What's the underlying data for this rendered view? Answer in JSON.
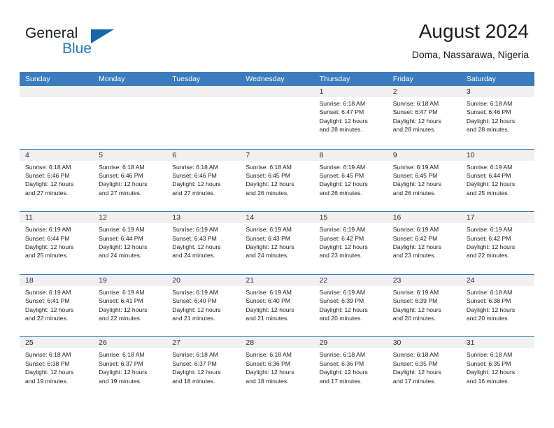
{
  "brand": {
    "word1": "General",
    "word2": "Blue",
    "flag_icon": "triangle-flag-icon",
    "accent_color": "#1566ab",
    "text_color": "#1f7ac4"
  },
  "header": {
    "title": "August 2024",
    "subtitle": "Doma, Nassarawa, Nigeria"
  },
  "calendar": {
    "header_bg": "#3a7cbe",
    "day_header_bg": "#f0f0f0",
    "weekdays": [
      "Sunday",
      "Monday",
      "Tuesday",
      "Wednesday",
      "Thursday",
      "Friday",
      "Saturday"
    ],
    "weeks": [
      [
        {
          "day": "",
          "lines": []
        },
        {
          "day": "",
          "lines": []
        },
        {
          "day": "",
          "lines": []
        },
        {
          "day": "",
          "lines": []
        },
        {
          "day": "1",
          "lines": [
            "Sunrise: 6:18 AM",
            "Sunset: 6:47 PM",
            "Daylight: 12 hours",
            "and 28 minutes."
          ]
        },
        {
          "day": "2",
          "lines": [
            "Sunrise: 6:18 AM",
            "Sunset: 6:47 PM",
            "Daylight: 12 hours",
            "and 28 minutes."
          ]
        },
        {
          "day": "3",
          "lines": [
            "Sunrise: 6:18 AM",
            "Sunset: 6:46 PM",
            "Daylight: 12 hours",
            "and 28 minutes."
          ]
        }
      ],
      [
        {
          "day": "4",
          "lines": [
            "Sunrise: 6:18 AM",
            "Sunset: 6:46 PM",
            "Daylight: 12 hours",
            "and 27 minutes."
          ]
        },
        {
          "day": "5",
          "lines": [
            "Sunrise: 6:18 AM",
            "Sunset: 6:46 PM",
            "Daylight: 12 hours",
            "and 27 minutes."
          ]
        },
        {
          "day": "6",
          "lines": [
            "Sunrise: 6:18 AM",
            "Sunset: 6:46 PM",
            "Daylight: 12 hours",
            "and 27 minutes."
          ]
        },
        {
          "day": "7",
          "lines": [
            "Sunrise: 6:18 AM",
            "Sunset: 6:45 PM",
            "Daylight: 12 hours",
            "and 26 minutes."
          ]
        },
        {
          "day": "8",
          "lines": [
            "Sunrise: 6:19 AM",
            "Sunset: 6:45 PM",
            "Daylight: 12 hours",
            "and 26 minutes."
          ]
        },
        {
          "day": "9",
          "lines": [
            "Sunrise: 6:19 AM",
            "Sunset: 6:45 PM",
            "Daylight: 12 hours",
            "and 26 minutes."
          ]
        },
        {
          "day": "10",
          "lines": [
            "Sunrise: 6:19 AM",
            "Sunset: 6:44 PM",
            "Daylight: 12 hours",
            "and 25 minutes."
          ]
        }
      ],
      [
        {
          "day": "11",
          "lines": [
            "Sunrise: 6:19 AM",
            "Sunset: 6:44 PM",
            "Daylight: 12 hours",
            "and 25 minutes."
          ]
        },
        {
          "day": "12",
          "lines": [
            "Sunrise: 6:19 AM",
            "Sunset: 6:44 PM",
            "Daylight: 12 hours",
            "and 24 minutes."
          ]
        },
        {
          "day": "13",
          "lines": [
            "Sunrise: 6:19 AM",
            "Sunset: 6:43 PM",
            "Daylight: 12 hours",
            "and 24 minutes."
          ]
        },
        {
          "day": "14",
          "lines": [
            "Sunrise: 6:19 AM",
            "Sunset: 6:43 PM",
            "Daylight: 12 hours",
            "and 24 minutes."
          ]
        },
        {
          "day": "15",
          "lines": [
            "Sunrise: 6:19 AM",
            "Sunset: 6:42 PM",
            "Daylight: 12 hours",
            "and 23 minutes."
          ]
        },
        {
          "day": "16",
          "lines": [
            "Sunrise: 6:19 AM",
            "Sunset: 6:42 PM",
            "Daylight: 12 hours",
            "and 23 minutes."
          ]
        },
        {
          "day": "17",
          "lines": [
            "Sunrise: 6:19 AM",
            "Sunset: 6:42 PM",
            "Daylight: 12 hours",
            "and 22 minutes."
          ]
        }
      ],
      [
        {
          "day": "18",
          "lines": [
            "Sunrise: 6:19 AM",
            "Sunset: 6:41 PM",
            "Daylight: 12 hours",
            "and 22 minutes."
          ]
        },
        {
          "day": "19",
          "lines": [
            "Sunrise: 6:19 AM",
            "Sunset: 6:41 PM",
            "Daylight: 12 hours",
            "and 22 minutes."
          ]
        },
        {
          "day": "20",
          "lines": [
            "Sunrise: 6:19 AM",
            "Sunset: 6:40 PM",
            "Daylight: 12 hours",
            "and 21 minutes."
          ]
        },
        {
          "day": "21",
          "lines": [
            "Sunrise: 6:19 AM",
            "Sunset: 6:40 PM",
            "Daylight: 12 hours",
            "and 21 minutes."
          ]
        },
        {
          "day": "22",
          "lines": [
            "Sunrise: 6:19 AM",
            "Sunset: 6:39 PM",
            "Daylight: 12 hours",
            "and 20 minutes."
          ]
        },
        {
          "day": "23",
          "lines": [
            "Sunrise: 6:19 AM",
            "Sunset: 6:39 PM",
            "Daylight: 12 hours",
            "and 20 minutes."
          ]
        },
        {
          "day": "24",
          "lines": [
            "Sunrise: 6:18 AM",
            "Sunset: 6:38 PM",
            "Daylight: 12 hours",
            "and 20 minutes."
          ]
        }
      ],
      [
        {
          "day": "25",
          "lines": [
            "Sunrise: 6:18 AM",
            "Sunset: 6:38 PM",
            "Daylight: 12 hours",
            "and 19 minutes."
          ]
        },
        {
          "day": "26",
          "lines": [
            "Sunrise: 6:18 AM",
            "Sunset: 6:37 PM",
            "Daylight: 12 hours",
            "and 19 minutes."
          ]
        },
        {
          "day": "27",
          "lines": [
            "Sunrise: 6:18 AM",
            "Sunset: 6:37 PM",
            "Daylight: 12 hours",
            "and 18 minutes."
          ]
        },
        {
          "day": "28",
          "lines": [
            "Sunrise: 6:18 AM",
            "Sunset: 6:36 PM",
            "Daylight: 12 hours",
            "and 18 minutes."
          ]
        },
        {
          "day": "29",
          "lines": [
            "Sunrise: 6:18 AM",
            "Sunset: 6:36 PM",
            "Daylight: 12 hours",
            "and 17 minutes."
          ]
        },
        {
          "day": "30",
          "lines": [
            "Sunrise: 6:18 AM",
            "Sunset: 6:35 PM",
            "Daylight: 12 hours",
            "and 17 minutes."
          ]
        },
        {
          "day": "31",
          "lines": [
            "Sunrise: 6:18 AM",
            "Sunset: 6:35 PM",
            "Daylight: 12 hours",
            "and 16 minutes."
          ]
        }
      ]
    ]
  }
}
